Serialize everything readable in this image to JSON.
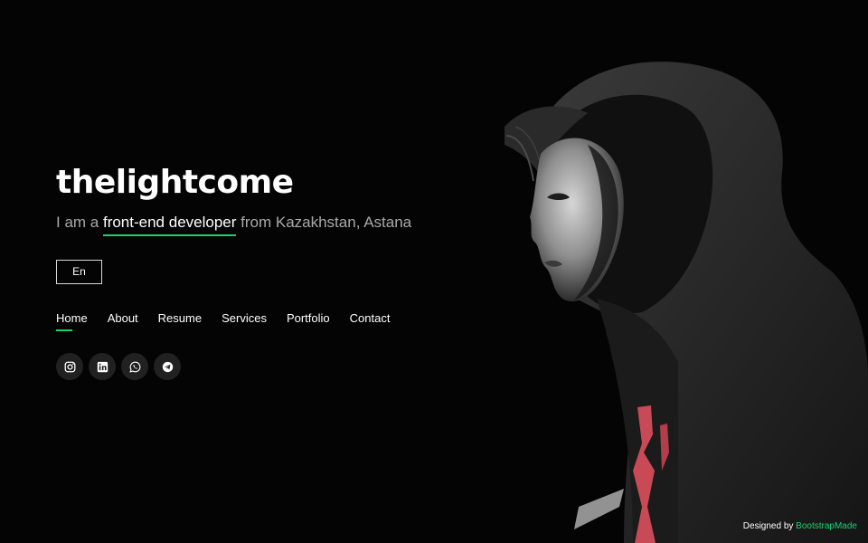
{
  "hero": {
    "title": "thelightcome",
    "tagline_prefix": "I am a ",
    "tagline_highlight": "front-end developer",
    "tagline_suffix": " from Kazakhstan, Astana"
  },
  "language_button": "En",
  "nav": {
    "items": [
      {
        "label": "Home",
        "active": true
      },
      {
        "label": "About"
      },
      {
        "label": "Resume"
      },
      {
        "label": "Services"
      },
      {
        "label": "Portfolio"
      },
      {
        "label": "Contact"
      }
    ]
  },
  "social": {
    "icons": [
      "instagram-icon",
      "linkedin-icon",
      "whatsapp-icon",
      "telegram-icon"
    ]
  },
  "footer": {
    "credit_prefix": "Designed by ",
    "credit_link": "BootstrapMade"
  },
  "colors": {
    "accent": "#18d26e",
    "background": "#040404",
    "social_bg": "#212121"
  }
}
